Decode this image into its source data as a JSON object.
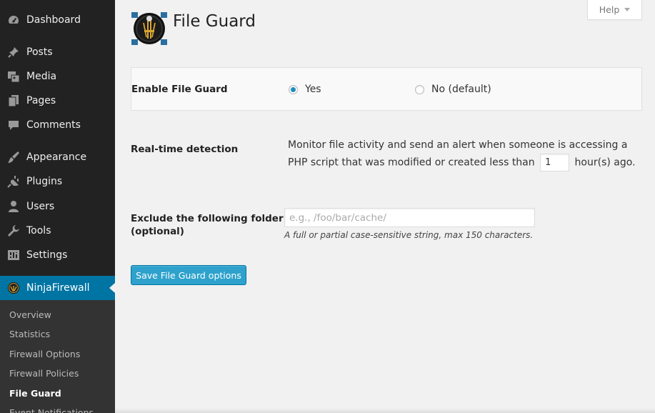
{
  "sidebar": {
    "items": [
      {
        "label": "Dashboard",
        "icon": "dashboard-icon"
      },
      {
        "label": "Posts",
        "icon": "pin-icon"
      },
      {
        "label": "Media",
        "icon": "media-icon"
      },
      {
        "label": "Pages",
        "icon": "pages-icon"
      },
      {
        "label": "Comments",
        "icon": "comment-icon"
      },
      {
        "label": "Appearance",
        "icon": "brush-icon"
      },
      {
        "label": "Plugins",
        "icon": "plug-icon"
      },
      {
        "label": "Users",
        "icon": "user-icon"
      },
      {
        "label": "Tools",
        "icon": "wrench-icon"
      },
      {
        "label": "Settings",
        "icon": "settings-icon"
      },
      {
        "label": "NinjaFirewall",
        "icon": "ninja-icon"
      }
    ],
    "submenu": [
      "Overview",
      "Statistics",
      "Firewall Options",
      "Firewall Policies",
      "File Guard",
      "Event Notifications"
    ],
    "current_submenu": "File Guard"
  },
  "header": {
    "title": "File Guard",
    "help_label": "Help"
  },
  "form": {
    "enable": {
      "label": "Enable File Guard",
      "yes_label": "Yes",
      "no_label": "No (default)",
      "selected": "Yes"
    },
    "realtime": {
      "label": "Real-time detection",
      "description_before": "Monitor file activity and send an alert when someone is accessing a PHP script that was modified or created less than",
      "hours_value": "1",
      "description_after": "hour(s) ago."
    },
    "exclude": {
      "label_line1": "Exclude the following folder",
      "label_line2": "(optional)",
      "placeholder": "e.g., /foo/bar/cache/",
      "value": "",
      "help": "A full or partial case-sensitive string, max 150 characters."
    },
    "save_label": "Save File Guard options"
  },
  "colors": {
    "sidebar_bg": "#222222",
    "active_bg": "#0074a2",
    "button_bg": "#2ea2cc",
    "page_bg": "#f1f1f1"
  }
}
